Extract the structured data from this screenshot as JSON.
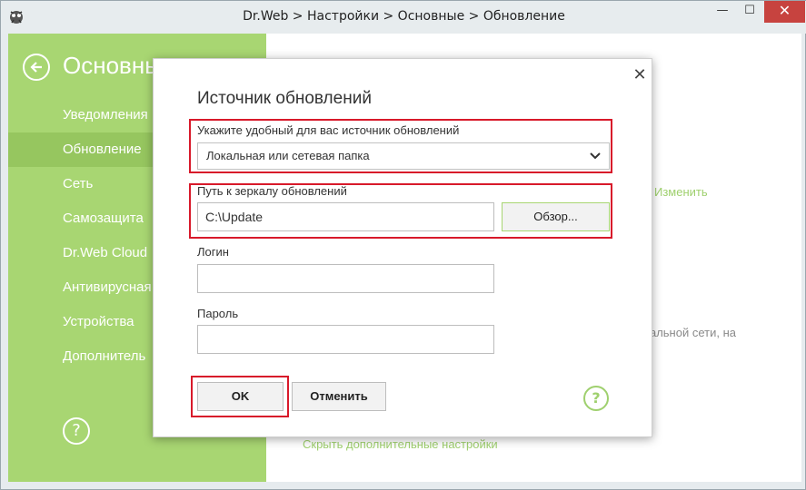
{
  "window": {
    "title": "Dr.Web > Настройки > Основные > Обновление",
    "min_label": "—",
    "max_label": "☐",
    "close_label": "✕"
  },
  "sidebar": {
    "title": "Основные",
    "items": [
      {
        "label": "Уведомления",
        "active": false
      },
      {
        "label": "Обновление",
        "active": true
      },
      {
        "label": "Сеть",
        "active": false
      },
      {
        "label": "Самозащита",
        "active": false
      },
      {
        "label": "Dr.Web Cloud",
        "active": false
      },
      {
        "label": "Антивирусная",
        "active": false
      },
      {
        "label": "Устройства",
        "active": false
      },
      {
        "label": "Дополнитель",
        "active": false
      }
    ],
    "help_label": "?"
  },
  "background": {
    "change_link": "Изменить",
    "lan_text": "кальной сети, на",
    "hide_link": "Скрыть дополнительные настройки"
  },
  "dialog": {
    "title": "Источник обновлений",
    "close_label": "✕",
    "source_label": "Укажите удобный для вас источник обновлений",
    "source_value": "Локальная или сетевая папка",
    "mirror_label": "Путь к зеркалу обновлений",
    "mirror_value": "C:\\Update",
    "browse_label": "Обзор...",
    "login_label": "Логин",
    "login_value": "",
    "password_label": "Пароль",
    "password_value": "",
    "ok_label": "OK",
    "cancel_label": "Отменить",
    "help_label": "?"
  },
  "colors": {
    "sidebar_green": "#a8d672",
    "sidebar_active": "#96c65f",
    "highlight_red": "#d8192a",
    "close_red": "#c7433f"
  }
}
